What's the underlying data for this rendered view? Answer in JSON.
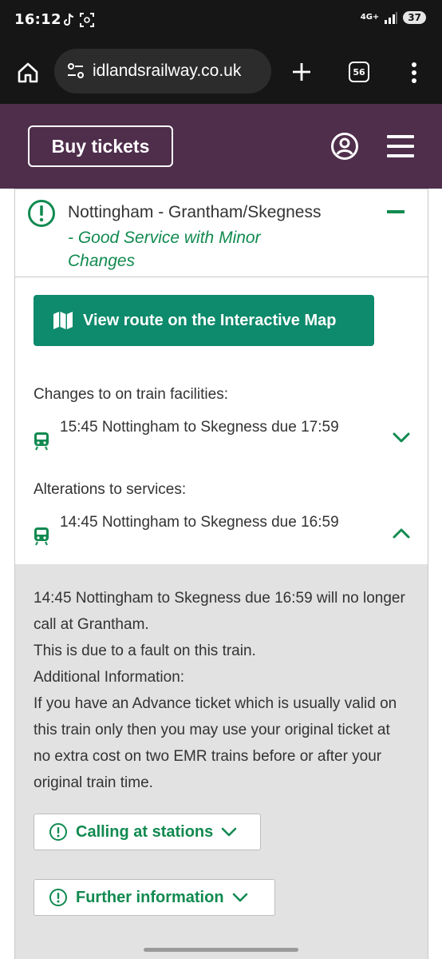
{
  "status_bar": {
    "time": "16:12",
    "network_label": "4G+",
    "battery_level": "37",
    "icons": [
      "tiktok-icon",
      "screenshot-icon",
      "signal-icon"
    ]
  },
  "browser": {
    "url": "idlandsrailway.co.uk",
    "tab_count": "56",
    "icons": [
      "home-icon",
      "site-settings-icon",
      "new-tab-plus-icon",
      "overflow-menu-icon"
    ]
  },
  "header": {
    "buy_tickets_label": "Buy tickets",
    "icons": [
      "account-icon",
      "hamburger-menu-icon"
    ],
    "brand_color": "#4f2e4c"
  },
  "route": {
    "title": "Nottingham - Grantham/Skegness",
    "status": "- Good Service with Minor Changes",
    "status_color": "#118a50",
    "map_button_label": "View route on the Interactive Map",
    "map_button_color": "#0e8a6c"
  },
  "sections": {
    "facilities_label": "Changes to on train facilities:",
    "facilities_item": "15:45 Nottingham to Skegness due 17:59",
    "alterations_label": "Alterations to services:",
    "alterations_item": "14:45 Nottingham to Skegness due 16:59"
  },
  "detail": {
    "lines": [
      "14:45 Nottingham to Skegness due 16:59 will no longer call at Grantham.",
      "This is due to a fault on this train.",
      "Additional Information:",
      "If you have an Advance ticket which is usually valid on this train only then you may use your original ticket at no extra cost on two EMR trains before or after your original train time."
    ],
    "calling_button": "Calling at stations",
    "further_button": "Further information"
  }
}
